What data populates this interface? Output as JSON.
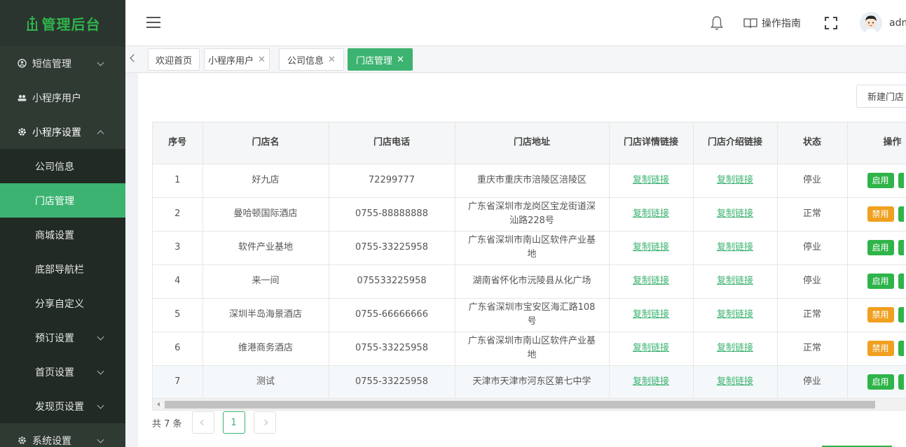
{
  "app": {
    "logo_text": "管理后台",
    "accent": "#3cb371"
  },
  "sidebar": {
    "items": [
      {
        "label": "短信管理",
        "icon": "user-circle-icon",
        "expandable": true
      },
      {
        "label": "小程序用户",
        "icon": "users-icon",
        "expandable": false
      },
      {
        "label": "小程序设置",
        "icon": "gear-icon",
        "expandable": true,
        "expanded": true
      }
    ],
    "submenu": [
      {
        "label": "公司信息"
      },
      {
        "label": "门店管理",
        "active": true
      },
      {
        "label": "商城设置"
      },
      {
        "label": "底部导航栏"
      },
      {
        "label": "分享自定义"
      },
      {
        "label": "预订设置",
        "expandable": true
      },
      {
        "label": "首页设置",
        "expandable": true
      },
      {
        "label": "发现页设置",
        "expandable": true
      }
    ],
    "footer_item": {
      "label": "系统设置",
      "icon": "gear-icon"
    }
  },
  "header": {
    "guide_label": "操作指南",
    "user_name": "admin"
  },
  "tabs": [
    {
      "label": "欢迎首页",
      "closable": false
    },
    {
      "label": "小程序用户",
      "closable": true
    },
    {
      "label": "公司信息",
      "closable": true
    },
    {
      "label": "门店管理",
      "closable": true,
      "active": true
    }
  ],
  "toolbar": {
    "new_label": "新建门店"
  },
  "table": {
    "columns": [
      "序号",
      "门店名",
      "门店电话",
      "门店地址",
      "门店详情链接",
      "门店介绍链接",
      "状态",
      "操作"
    ],
    "rows": [
      {
        "no": "1",
        "name": "好九店",
        "phone": "72299777",
        "address": "重庆市重庆市涪陵区涪陵区",
        "detail_link": "复制链接",
        "intro_link": "复制链接",
        "status": "停业",
        "action": "启用"
      },
      {
        "no": "2",
        "name": "曼哈顿国际酒店",
        "phone": "0755-88888888",
        "address": "广东省深圳市龙岗区宝龙街道深汕路228号",
        "detail_link": "复制链接",
        "intro_link": "复制链接",
        "status": "正常",
        "action": "禁用"
      },
      {
        "no": "3",
        "name": "软件产业基地",
        "phone": "0755-33225958",
        "address": "广东省深圳市南山区软件产业基地",
        "detail_link": "复制链接",
        "intro_link": "复制链接",
        "status": "停业",
        "action": "启用"
      },
      {
        "no": "4",
        "name": "来一间",
        "phone": "075533225958",
        "address": "湖南省怀化市沅陵县从化广场",
        "detail_link": "复制链接",
        "intro_link": "复制链接",
        "status": "停业",
        "action": "启用"
      },
      {
        "no": "5",
        "name": "深圳半岛海景酒店",
        "phone": "0755-66666666",
        "address": "广东省深圳市宝安区海汇路108号",
        "detail_link": "复制链接",
        "intro_link": "复制链接",
        "status": "正常",
        "action": "禁用"
      },
      {
        "no": "6",
        "name": "维港商务酒店",
        "phone": "0755-33225958",
        "address": "广东省深圳市南山区软件产业基地",
        "detail_link": "复制链接",
        "intro_link": "复制链接",
        "status": "正常",
        "action": "禁用"
      },
      {
        "no": "7",
        "name": "测试",
        "phone": "0755-33225958",
        "address": "天津市天津市河东区第七中学",
        "detail_link": "复制链接",
        "intro_link": "复制链接",
        "status": "停业",
        "action": "启用"
      }
    ]
  },
  "pagination": {
    "total_label": "共 7 条",
    "current_page": "1"
  }
}
